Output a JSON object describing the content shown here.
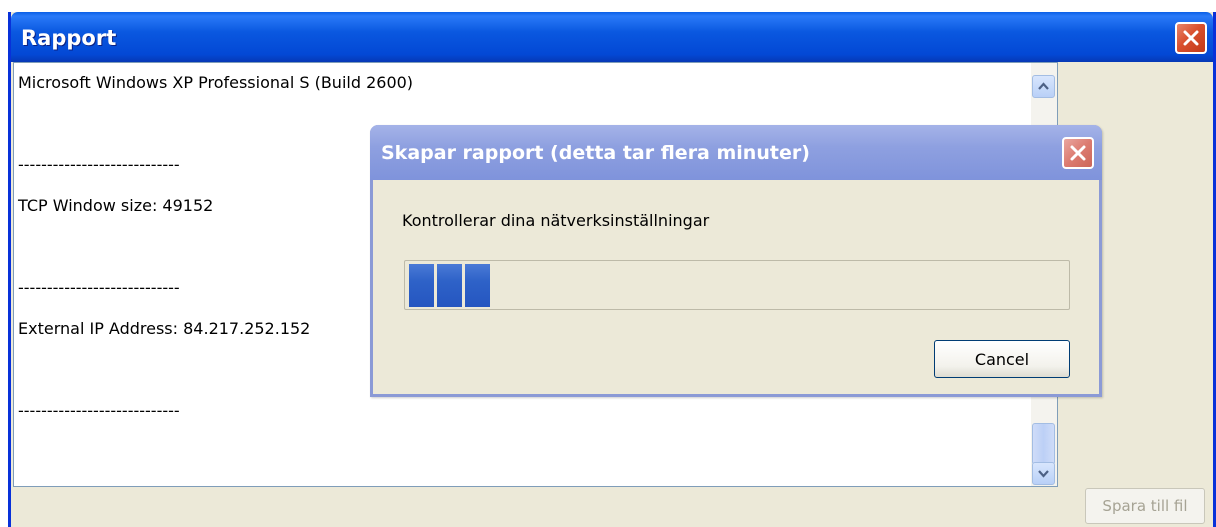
{
  "main_window": {
    "title": "Rapport",
    "report_lines": [
      "Microsoft Windows XP Professional S (Build 2600)",
      "",
      "----------------------------",
      "TCP Window size: 49152",
      "",
      "----------------------------",
      "External IP Address: 84.217.252.152",
      "",
      "----------------------------"
    ],
    "save_button_label": "Spara till fil"
  },
  "progress_dialog": {
    "title": "Skapar rapport (detta tar flera minuter)",
    "message": "Kontrollerar dina nätverksinställningar",
    "progress_blocks_filled": 3,
    "cancel_label": "Cancel"
  },
  "icons": {
    "close": "close-icon",
    "scroll_up": "chevron-up-icon",
    "scroll_down": "chevron-down-icon"
  },
  "colors": {
    "titlebar_active": "#0a58e0",
    "titlebar_inactive": "#8ea0e0",
    "progress_block": "#2e62c8",
    "window_bg": "#ece9d8"
  }
}
